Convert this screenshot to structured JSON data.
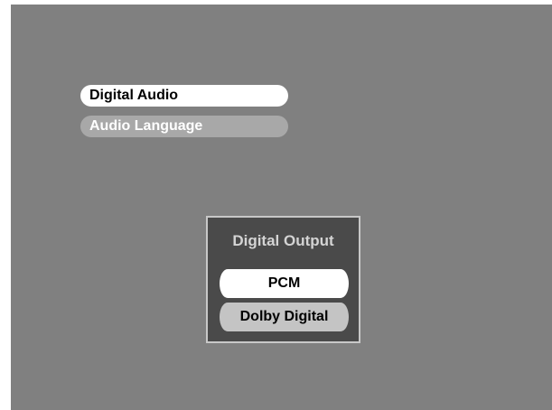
{
  "menu": {
    "items": [
      {
        "label": "Digital Audio",
        "selected": true
      },
      {
        "label": "Audio Language",
        "selected": false
      }
    ]
  },
  "dialog": {
    "title": "Digital Output",
    "options": [
      {
        "label": "PCM",
        "highlighted": true
      },
      {
        "label": "Dolby Digital",
        "highlighted": false
      }
    ]
  },
  "colors": {
    "screen_background": "#808080",
    "selected_item": "#ffffff",
    "unselected_item": "#a8a8a8",
    "dialog_background": "#4a4a4a",
    "dialog_border": "#c8c8c8"
  }
}
